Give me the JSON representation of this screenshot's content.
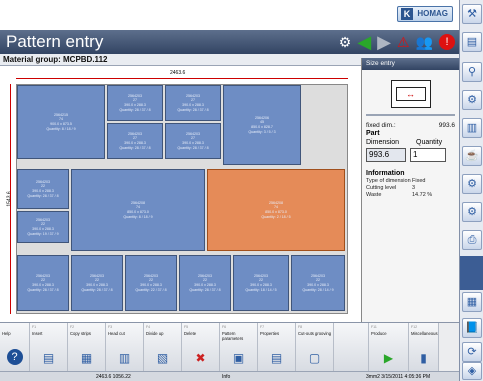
{
  "logo": {
    "mark": "K",
    "text": "HOMAG"
  },
  "header": {
    "title": "Pattern entry"
  },
  "toolbar": {
    "icons": [
      "tools-icon",
      "arrow-left-icon",
      "arrow-right-icon",
      "warning-icon",
      "people-icon",
      "stop-icon"
    ]
  },
  "material_group_label": "Material group: MCPBD.112",
  "canvas": {
    "width_label": "2463.6",
    "height_label": "1543.6",
    "parts": [
      {
        "lines": [
          "2564215",
          "74",
          "900.0 x 873.5",
          "Quantity: 8 / 18 / 9"
        ]
      },
      {
        "lines": [
          "2564203",
          "27",
          "390.0 x 288.3",
          "Quantity: 28 / 37 / 8"
        ]
      },
      {
        "lines": [
          "2564203",
          "27",
          "390.0 x 288.3",
          "Quantity: 28 / 37 / 8"
        ]
      },
      {
        "lines": [
          "2564203",
          "27",
          "390.0 x 288.3",
          "Quantity: 28 / 37 / 8"
        ]
      },
      {
        "lines": [
          "2564203",
          "27",
          "390.0 x 288.3",
          "Quantity: 28 / 37 / 8"
        ]
      },
      {
        "lines": [
          "2564206",
          "45",
          "850.0 x 828.7",
          "Quantity: 3 / 5 / 3"
        ]
      },
      {
        "lines": [
          "2564203",
          "22",
          "390.0 x 288.3",
          "Quantity: 28 / 37 / 8"
        ]
      },
      {
        "lines": [
          "2564203",
          "22",
          "390.0 x 288.3",
          "Quantity: 19 / 37 / 9"
        ]
      },
      {
        "lines": [
          "2564208",
          "74",
          "850.0 x 873.0",
          "Quantity: 8 / 18 / 9"
        ]
      },
      {
        "lines": [
          "2564208",
          "74",
          "850.0 x 873.0",
          "Quantity: 2 / 18 / 5"
        ]
      },
      {
        "lines": [
          "2564203",
          "22",
          "390.0 x 288.3",
          "Quantity: 28 / 37 / 8"
        ]
      },
      {
        "lines": [
          "2564203",
          "22",
          "390.0 x 288.3",
          "Quantity: 28 / 37 / 8"
        ]
      },
      {
        "lines": [
          "2564203",
          "22",
          "390.0 x 288.3",
          "Quantity: 22 / 37 / 8"
        ]
      },
      {
        "lines": [
          "2564203",
          "22",
          "390.0 x 288.3",
          "Quantity: 28 / 37 / 8"
        ]
      },
      {
        "lines": [
          "2564203",
          "22",
          "390.0 x 288.3",
          "Quantity: 18 / 14 / 5"
        ]
      },
      {
        "lines": [
          "2564203",
          "22",
          "390.0 x 288.3",
          "Quantity: 28 / 14 / 9"
        ]
      },
      {
        "lines": [
          "2564203",
          "22",
          "390.0 x 288.3",
          "Quantity: 28 / 14 / 9"
        ]
      }
    ]
  },
  "size_entry": {
    "header": "Size entry",
    "icon_symbol": "↔",
    "fixed_dim_label": "fixed dim.:",
    "fixed_dim_value": "993.6",
    "part_title": "Part",
    "dimension_label": "Dimension",
    "quantity_label": "Quantity",
    "dimension_value": "993.6",
    "quantity_value": "1",
    "info_title": "Information",
    "info": [
      {
        "k": "Type of dimension",
        "v": "Fixed"
      },
      {
        "k": "Cutting level",
        "v": "3"
      },
      {
        "k": "Waste",
        "v": "14.72 %"
      }
    ]
  },
  "rightbar": [
    "machine-icon",
    "pattern-icon",
    "search-icon",
    "saw-icon",
    "stack-icon",
    "cup-icon",
    "gear-icon",
    "settings-icon",
    "print-icon",
    "stack2-icon",
    "help-book-icon",
    "refresh-icon",
    "layers-icon"
  ],
  "functions": [
    {
      "f": "",
      "label": "Help",
      "icon": "?"
    },
    {
      "f": "F1",
      "label": "Insert",
      "icon": "▤"
    },
    {
      "f": "F2",
      "label": "Copy strips",
      "icon": "▦"
    },
    {
      "f": "F3",
      "label": "Head cut",
      "icon": "▥"
    },
    {
      "f": "F4",
      "label": "Divide up",
      "icon": "▧"
    },
    {
      "f": "F5",
      "label": "Delete",
      "icon": "✖"
    },
    {
      "f": "F6",
      "label": "Pattern parameters",
      "icon": "▣"
    },
    {
      "f": "F7",
      "label": "Properties",
      "icon": "▤"
    },
    {
      "f": "F8",
      "label": "Cut-outs grooving",
      "icon": "▢"
    },
    {
      "f": "",
      "label": "",
      "icon": ""
    },
    {
      "f": "F11",
      "label": "Produce",
      "icon": "▶"
    },
    {
      "f": "F12",
      "label": "Miscellaneous",
      "icon": "▮"
    }
  ],
  "status": {
    "center": "2463.6 1056.22",
    "mid": "Info",
    "right": "3mm2    3/15/2011 4:05:36 PM"
  }
}
